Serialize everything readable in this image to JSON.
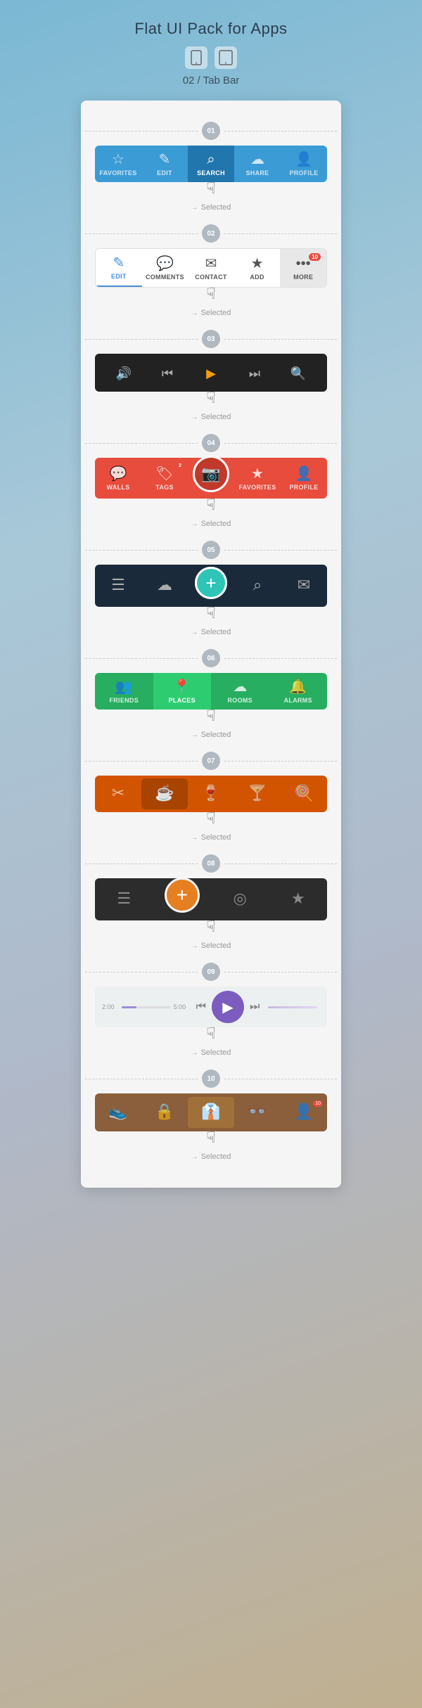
{
  "header": {
    "title": "Flat UI Pack for Apps",
    "subtitle": "02 / Tab Bar"
  },
  "sections": [
    {
      "step": "01",
      "tabbar": "blue-tabbar",
      "tabs": [
        {
          "icon": "☆",
          "label": "Favorites",
          "active": false
        },
        {
          "icon": "✏",
          "label": "Edit",
          "active": false
        },
        {
          "icon": "🔍",
          "label": "Search",
          "active": true
        },
        {
          "icon": "☁",
          "label": "Share",
          "active": false
        },
        {
          "icon": "👤",
          "label": "Profile",
          "active": false
        }
      ],
      "selected": "Selected"
    },
    {
      "step": "02",
      "tabbar": "white-tabbar",
      "tabs": [
        {
          "icon": "✏",
          "label": "Edit",
          "active": true,
          "badge": null
        },
        {
          "icon": "💬",
          "label": "Comments",
          "active": false,
          "badge": null
        },
        {
          "icon": "✉",
          "label": "Contact",
          "active": false,
          "badge": null
        },
        {
          "icon": "★",
          "label": "Add",
          "active": false,
          "badge": null
        },
        {
          "icon": "•••",
          "label": "More",
          "active": false,
          "badge": "10"
        }
      ],
      "selected": "Selected"
    },
    {
      "step": "03",
      "tabbar": "dark-player",
      "selected": "Selected"
    },
    {
      "step": "04",
      "tabbar": "red-social",
      "tabs": [
        {
          "icon": "💬",
          "label": "WALLS",
          "active": false
        },
        {
          "icon": "🏷",
          "label": "TAGS",
          "active": false
        },
        {
          "icon": "📷",
          "label": "",
          "active": true,
          "center": true
        },
        {
          "icon": "★",
          "label": "FAVORITES",
          "active": false
        },
        {
          "icon": "👤",
          "label": "PROFILE",
          "active": false
        }
      ],
      "selected": "Selected"
    },
    {
      "step": "05",
      "tabbar": "dark-teal",
      "tabs": [
        {
          "icon": "☰",
          "active": false
        },
        {
          "icon": "☁",
          "active": false
        },
        {
          "icon": "+",
          "active": true,
          "center": true
        },
        {
          "icon": "🔍",
          "active": false
        },
        {
          "icon": "✉",
          "active": false
        }
      ],
      "selected": "Selected"
    },
    {
      "step": "06",
      "tabbar": "green-nav",
      "tabs": [
        {
          "icon": "👥",
          "label": "FRIENDS",
          "active": false
        },
        {
          "icon": "📍",
          "label": "PLACES",
          "active": true
        },
        {
          "icon": "☁",
          "label": "ROOMS",
          "active": false
        },
        {
          "icon": "🔔",
          "label": "ALARMS",
          "active": false
        }
      ],
      "selected": "Selected"
    },
    {
      "step": "07",
      "tabbar": "orange-food",
      "tabs": [
        {
          "icon": "✂",
          "active": false
        },
        {
          "icon": "☕",
          "active": true
        },
        {
          "icon": "🍷",
          "active": false
        },
        {
          "icon": "🍸",
          "active": false
        },
        {
          "icon": "🍭",
          "active": false
        }
      ],
      "selected": "Selected"
    },
    {
      "step": "08",
      "tabbar": "dark-plus",
      "tabs": [
        {
          "icon": "☰",
          "active": false
        },
        {
          "icon": "+",
          "active": true,
          "center": true
        },
        {
          "icon": "⊙",
          "active": false
        },
        {
          "icon": "★",
          "active": false
        }
      ],
      "selected": "Selected"
    },
    {
      "step": "09",
      "tabbar": "light-player",
      "selected": "Selected",
      "time_start": "2:00",
      "time_end": "5:00"
    },
    {
      "step": "10",
      "tabbar": "brown-vintage",
      "tabs": [
        {
          "icon": "👟",
          "active": false
        },
        {
          "icon": "🔒",
          "active": false
        },
        {
          "icon": "👔",
          "active": true
        },
        {
          "icon": "👓",
          "active": false
        },
        {
          "icon": "👤",
          "active": false,
          "badge": "10"
        }
      ],
      "selected": "Selected"
    }
  ]
}
